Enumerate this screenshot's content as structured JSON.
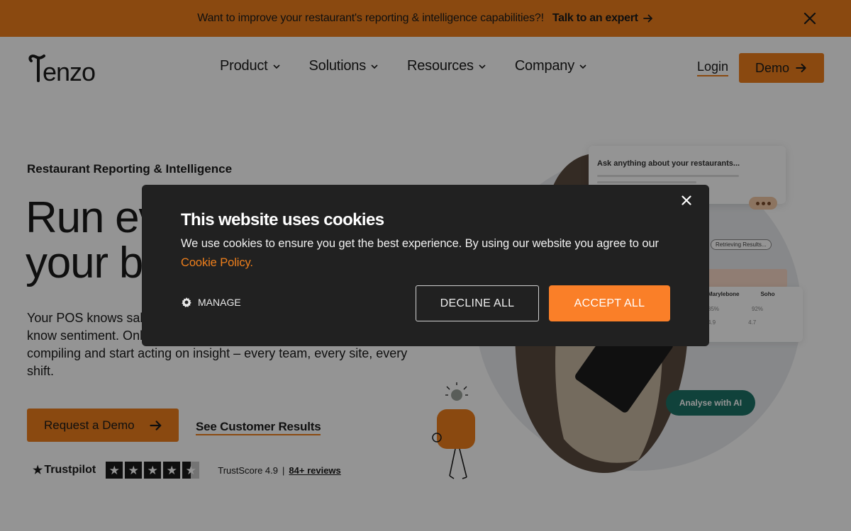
{
  "banner": {
    "message": "Want to improve your restaurant's reporting & intelligence capabilities?!",
    "cta_label": "Talk to an expert",
    "background": "#ee7f1c"
  },
  "header": {
    "logo_text": "Tenzo",
    "nav": [
      {
        "label": "Product"
      },
      {
        "label": "Solutions"
      },
      {
        "label": "Resources"
      },
      {
        "label": "Company"
      }
    ],
    "login_label": "Login",
    "demo_label": "Demo"
  },
  "hero": {
    "eyebrow": "Restaurant Reporting & Intelligence",
    "headline_line1": "Run every site like",
    "headline_line2": "your best site.",
    "body": "Your POS knows sales. Your scheduler knows labour. Your reviews know sentiment. Only Tenzo knows what to do about it. Stop compiling and start acting on insight – every team, every site, every shift.",
    "primary_cta": "Request a Demo",
    "secondary_cta": "See Customer Results",
    "trustpilot": {
      "brand": "Trustpilot",
      "rating": 4.5,
      "score_text": "TrustScore 4.9",
      "separator": "|",
      "reviews_text": "84+ reviews"
    },
    "art": {
      "ask_prompt": "Ask anything about your restaurants...",
      "retrieving": "Retrieving Results...",
      "table": {
        "columns": [
          "Marylebone",
          "Soho"
        ],
        "values": [
          "85%",
          "92%"
        ],
        "values2": [
          "4.9",
          "4.7"
        ]
      },
      "analyse_label": "Analyse with AI"
    }
  },
  "cookie_modal": {
    "title": "This website uses cookies",
    "text": "We use cookies to ensure you get the best experience. By using our website you agree to our",
    "policy_link": "Cookie Policy.",
    "manage_label": "MANAGE",
    "decline_label": "DECLINE ALL",
    "accept_label": "ACCEPT ALL",
    "accent": "#fa7f28"
  },
  "icons": {
    "banner_close": "close-icon",
    "nav_chevron": "chevron-down-icon",
    "arrow": "arrow-right-icon",
    "settings": "gear-icon",
    "modal_close": "close-icon"
  }
}
